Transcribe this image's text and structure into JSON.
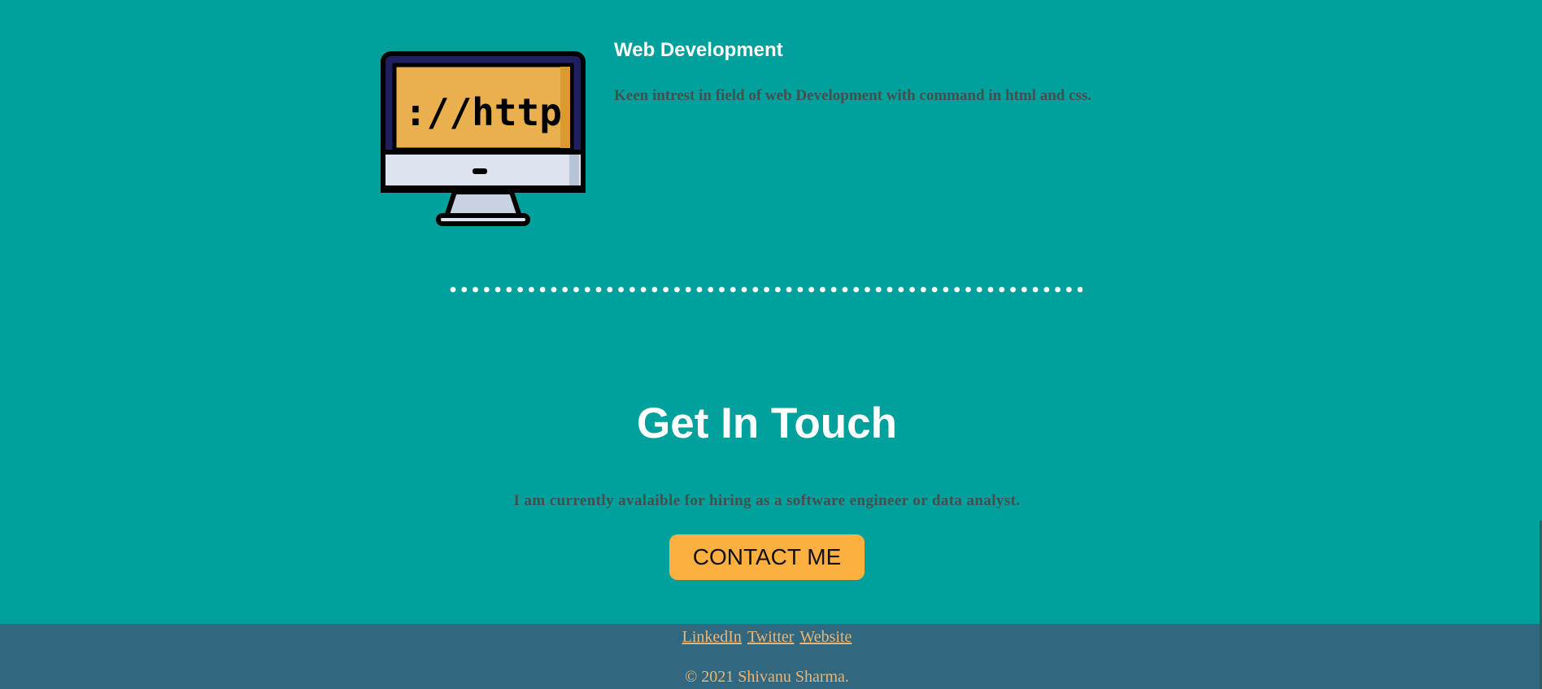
{
  "skill": {
    "title": "Web Development",
    "description": "Keen intrest in field of web Development with command in html and css.",
    "image_icon": "computer-http-icon",
    "image_text": "://http"
  },
  "contact": {
    "title": "Get In Touch",
    "description": "I am currently avalaible for hiring as a software engineer or data analyst.",
    "button_label": "CONTACT ME"
  },
  "footer": {
    "links": [
      {
        "label": "LinkedIn"
      },
      {
        "label": "Twitter"
      },
      {
        "label": "Website"
      }
    ],
    "copyright": "© 2021 Shivanu Sharma."
  },
  "colors": {
    "background": "#00a19d",
    "footer_background": "#31687f",
    "button": "#fcb040",
    "footer_text": "#eab676",
    "muted_text": "#40514e",
    "heading_text": "#ffffff"
  }
}
